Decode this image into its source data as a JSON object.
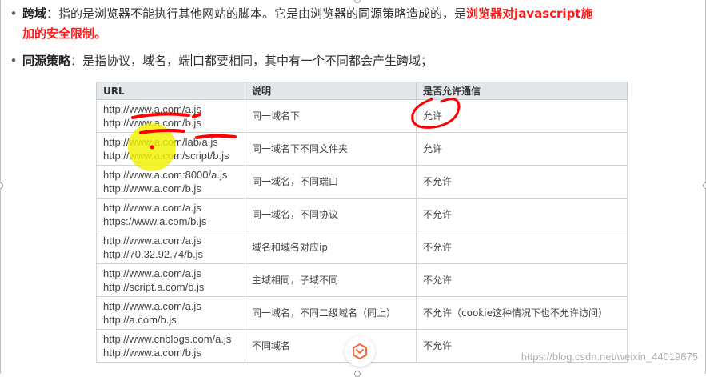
{
  "bullets": {
    "cross_domain": {
      "term": "跨域",
      "sep": "：",
      "text": "指的是浏览器不能执行其他网站的脚本。它是由浏览器的同源策略造成的，是",
      "highlight_line1": "浏览器对javascript施",
      "highlight_line2": "加的安全限制",
      "end": "。"
    },
    "same_origin": {
      "term": "同源策略",
      "text_before_cursor": "：是指协议，域名，端",
      "text_after_cursor": "口都要相同，其中有一个不同都会产生跨域；"
    }
  },
  "table": {
    "headers": [
      "URL",
      "说明",
      "是否允许通信"
    ],
    "rows": [
      {
        "url1": "http://www.a.com/a.js",
        "url2": "http://www.a.com/b.js",
        "desc": "同一域名下",
        "allow": "允许"
      },
      {
        "url1": "http://www.a.com/lab/a.js",
        "url2": "http://www.a.com/script/b.js",
        "desc": "同一域名下不同文件夹",
        "allow": "允许"
      },
      {
        "url1": "http://www.a.com:8000/a.js",
        "url2": "http://www.a.com/b.js",
        "desc": "同一域名，不同端口",
        "allow": "不允许"
      },
      {
        "url1": "http://www.a.com/a.js",
        "url2": "https://www.a.com/b.js",
        "desc": "同一域名，不同协议",
        "allow": "不允许"
      },
      {
        "url1": "http://www.a.com/a.js",
        "url2": "http://70.32.92.74/b.js",
        "desc": "域名和域名对应ip",
        "allow": "不允许"
      },
      {
        "url1": "http://www.a.com/a.js",
        "url2": "http://script.a.com/b.js",
        "desc": "主域相同，子域不同",
        "allow": "不允许"
      },
      {
        "url1": "http://www.a.com/a.js",
        "url2": "http://a.com/b.js",
        "desc": "同一域名，不同二级域名（同上）",
        "allow": "不允许（cookie这种情况下也不允许访问）"
      },
      {
        "url1": "http://www.cnblogs.com/a.js",
        "url2": "http://www.a.com/b.js",
        "desc": "不同域名",
        "allow": "不允许"
      }
    ]
  },
  "watermark": "https://blog.csdn.net/weixin_44019875",
  "colors": {
    "highlight_red": "#ff1a1a",
    "annotation_red": "#ff0000",
    "highlighter_yellow": "#f2f200",
    "header_bg": "#e4e7ea",
    "logo_orange": "#f26b3a"
  },
  "icons": {
    "logo": "csdn-edit-logo-icon",
    "bullet": "bullet-dot-icon"
  }
}
